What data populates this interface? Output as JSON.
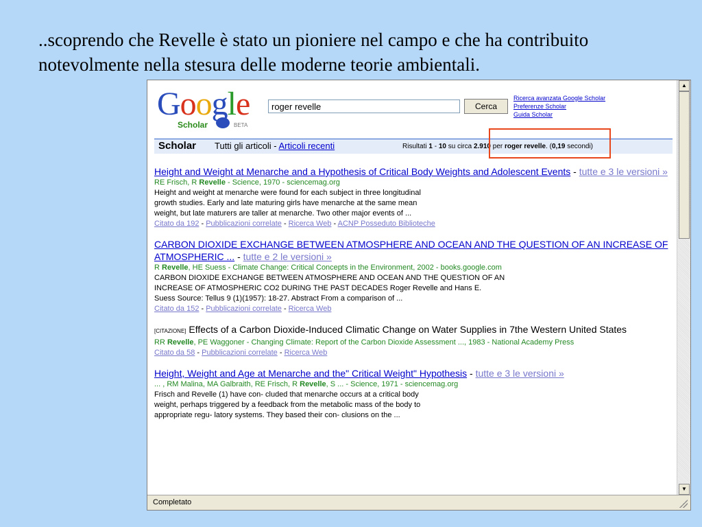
{
  "slide": {
    "caption": "..scoprendo che Revelle è stato un pioniere nel campo e che ha contribuito notevolmente nella stesura delle moderne teorie ambientali."
  },
  "header": {
    "logo": {
      "word": "Google",
      "subtitle": "Scholar",
      "badge": "BETA"
    },
    "search_value": "roger revelle",
    "search_button": "Cerca",
    "links": [
      "Ricerca avanzata Google Scholar",
      "Preferenze Scholar",
      "Guida Scholar"
    ]
  },
  "bar": {
    "title": "Scholar",
    "tab_all": "Tutti gli articoli",
    "separator": "-",
    "tab_recent": "Articoli recenti",
    "stats": {
      "prefix": "Risultati",
      "from": "1",
      "dash": "-",
      "to": "10",
      "of": "su circa",
      "total": "2.910",
      "for": "per",
      "query": "roger revelle",
      "time_open": ". (",
      "time": "0,19",
      "time_close": "secondi)"
    }
  },
  "results": [
    {
      "title": "Height and Weight at Menarche and a Hypothesis of Critical Body Weights and Adolescent Events",
      "versions": "tutte e 3 le versioni »",
      "meta_pre": "RE Frisch, R",
      "meta_author": "Revelle",
      "meta_post": " - Science, 1970 - sciencemag.org",
      "snippet": [
        "Height and weight at menarche were found for each subject in three longitudinal",
        "growth studies. Early and late maturing girls have menarche at the same mean",
        "weight, but late maturers are taller at menarche. Two other major events of ..."
      ],
      "links": [
        "Citato da 192",
        "Pubblicazioni correlate",
        "Ricerca Web",
        "ACNP Posseduto Biblioteche"
      ]
    },
    {
      "title": "CARBON DIOXIDE EXCHANGE BETWEEN ATMOSPHERE AND OCEAN AND THE QUESTION OF AN INCREASE OF ATMOSPHERIC ...",
      "versions": "tutte e 2 le versioni »",
      "meta_pre": "R",
      "meta_author": "Revelle",
      "meta_post": ", HE Suess - Climate Change: Critical Concepts in the Environment, 2002 - books.google.com",
      "snippet": [
        "CARBON DIOXIDE EXCHANGE BETWEEN ATMOSPHERE AND OCEAN AND THE QUESTION OF AN",
        "INCREASE OF ATMOSPHERIC CO2 DURING THE PAST DECADES Roger Revelle and Hans E.",
        "Suess Source: Tellus 9 (1)(1957): 18-27. Abstract From a comparison of ..."
      ],
      "links": [
        "Citato da 152",
        "Pubblicazioni correlate",
        "Ricerca Web"
      ]
    },
    {
      "tag": "[CITAZIONE]",
      "title": "Effects of a Carbon Dioxide-Induced Climatic Change on Water Supplies in 7the Western United States",
      "meta_pre": "RR",
      "meta_author": "Revelle",
      "meta_post": ", PE Waggoner - Changing Climate: Report of the Carbon Dioxide Assessment ..., 1983 - National Academy Press",
      "links": [
        "Citato da 58",
        "Pubblicazioni correlate",
        "Ricerca Web"
      ]
    },
    {
      "title": "Height, Weight and Age at Menarche and the\" Critical Weight\" Hypothesis",
      "versions": "tutte e 3 le versioni »",
      "meta_pre": "... , RM Malina, MA Galbraith, RE Frisch, R",
      "meta_author": "Revelle",
      "meta_post": ", S ... - Science, 1971 - sciencemag.org",
      "snippet": [
        "Frisch and Revelle (1) have con- cluded that menarche occurs at a critical body",
        "weight, perhaps triggered by a feedback from the metabolic mass of the body to",
        "appropriate regu- latory systems. They based their con- clusions on the ..."
      ]
    }
  ],
  "status": "Completato",
  "colors": {
    "highlight": "#e8471b",
    "link": "#0000cc",
    "meta": "#228822",
    "slide_bg": "#b6d8f8"
  }
}
